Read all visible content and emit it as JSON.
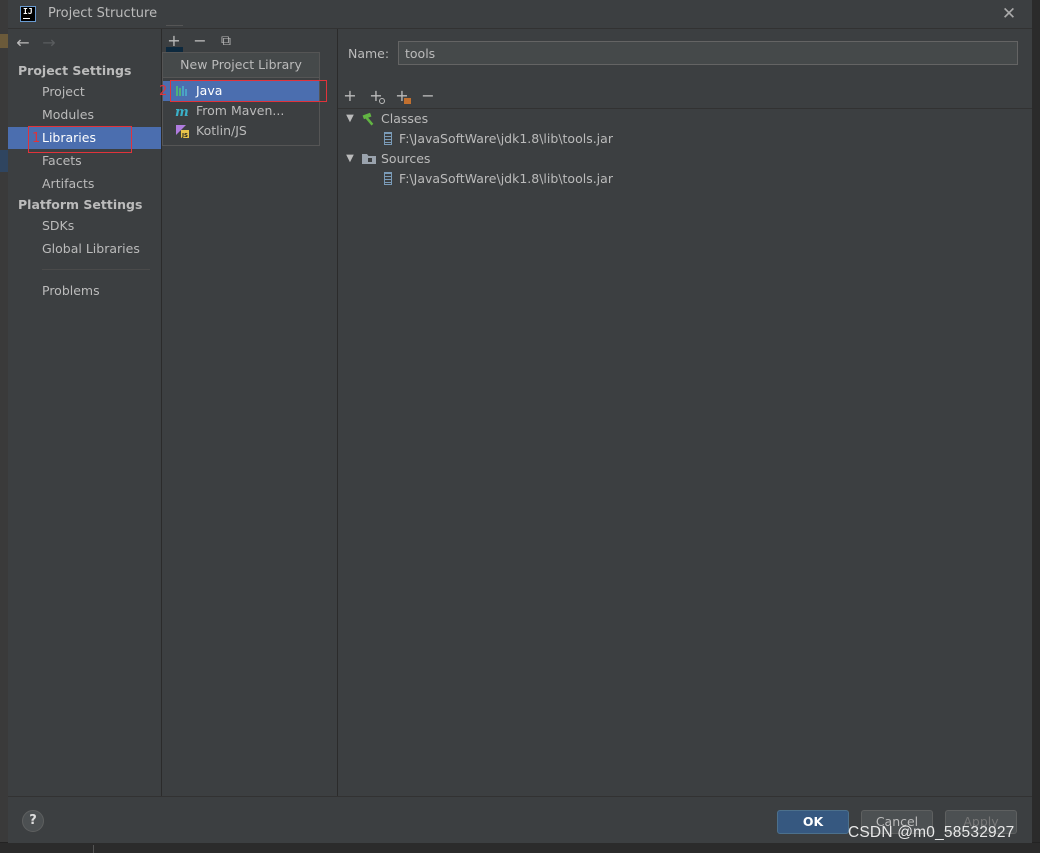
{
  "window": {
    "title": "Project Structure",
    "close_symbol": "✕",
    "app_icon_text": "IJ"
  },
  "nav": {
    "back_symbol": "←",
    "forward_symbol": "→",
    "project_settings_header": "Project Settings",
    "project_items": [
      {
        "label": "Project"
      },
      {
        "label": "Modules"
      },
      {
        "label": "Libraries",
        "selected": true
      },
      {
        "label": "Facets"
      },
      {
        "label": "Artifacts"
      }
    ],
    "platform_settings_header": "Platform Settings",
    "platform_items": [
      {
        "label": "SDKs"
      },
      {
        "label": "Global Libraries"
      }
    ],
    "problems_label": "Problems"
  },
  "middle": {
    "add_symbol": "+",
    "remove_symbol": "−",
    "copy_symbol": "⧉"
  },
  "popup": {
    "title": "New Project Library",
    "items": [
      {
        "label": "Java",
        "icon": "java-library-icon",
        "selected": true
      },
      {
        "label": "From Maven...",
        "icon": "maven-icon"
      },
      {
        "label": "Kotlin/JS",
        "icon": "kotlin-js-icon"
      }
    ]
  },
  "annotations": {
    "step1": "1",
    "step2": "2",
    "color": "#e0333b"
  },
  "library": {
    "name_label": "Name:",
    "name_value": "tools",
    "toolbar": {
      "add": "+",
      "add_specific": "+",
      "add_root": "+",
      "remove": "−"
    },
    "tree": [
      {
        "label": "Classes",
        "icon": "hammer-icon",
        "children": [
          "F:\\JavaSoftWare\\jdk1.8\\lib\\tools.jar"
        ]
      },
      {
        "label": "Sources",
        "icon": "folder-icon",
        "children": [
          "F:\\JavaSoftWare\\jdk1.8\\lib\\tools.jar"
        ]
      }
    ]
  },
  "footer": {
    "help": "?",
    "ok": "OK",
    "cancel": "Cancel",
    "apply": "Apply"
  },
  "watermark": "CSDN @m0_58532927",
  "colors": {
    "selection": "#4b6eaf",
    "panel": "#3c3f41",
    "text": "#bbbbbb",
    "ok_button": "#365880"
  }
}
